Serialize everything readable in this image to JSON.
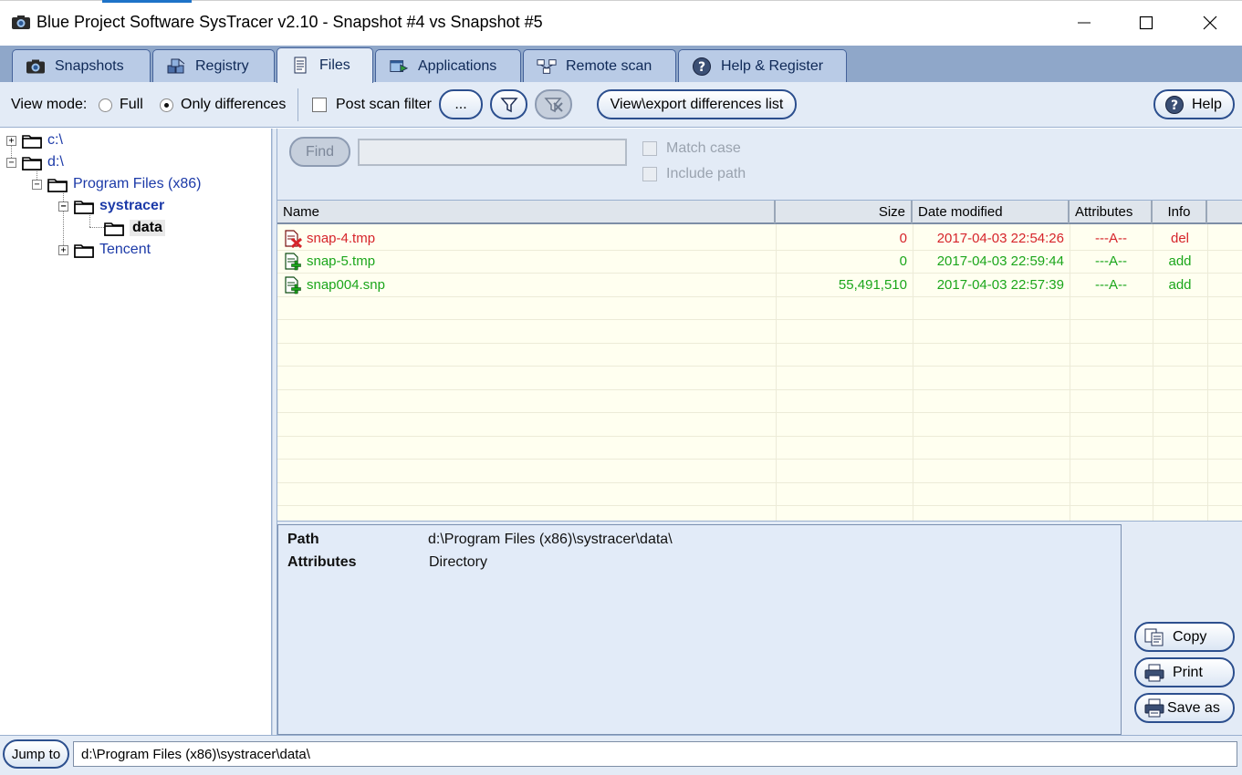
{
  "window": {
    "title": "Blue Project Software SysTracer v2.10 - Snapshot #4 vs Snapshot #5",
    "icon": "camera-icon"
  },
  "tabs": [
    {
      "label": "Snapshots",
      "icon": "camera-icon",
      "active": false
    },
    {
      "label": "Registry",
      "icon": "registry-cubes-icon",
      "active": false
    },
    {
      "label": "Files",
      "icon": "document-icon",
      "active": true
    },
    {
      "label": "Applications",
      "icon": "applications-icon",
      "active": false
    },
    {
      "label": "Remote scan",
      "icon": "network-icon",
      "active": false
    },
    {
      "label": "Help & Register",
      "icon": "question-icon",
      "active": false
    }
  ],
  "toolbar": {
    "view_mode_label": "View mode:",
    "full_label": "Full",
    "only_diff_label": "Only differences",
    "selected_mode": "Only differences",
    "post_scan_filter_label": "Post scan filter",
    "post_scan_filter_checked": false,
    "ellipsis_label": "...",
    "view_export_label": "View\\export differences list",
    "help_label": "Help"
  },
  "tree": {
    "nodes": [
      {
        "label": "c:\\",
        "expander": "+"
      },
      {
        "label": "d:\\",
        "expander": "−"
      },
      {
        "label": "Program Files (x86)",
        "expander": "−"
      },
      {
        "label": "systracer",
        "expander": "−"
      },
      {
        "label": "data",
        "selected": true
      },
      {
        "label": "Tencent",
        "expander": "+"
      }
    ]
  },
  "find": {
    "button_label": "Find",
    "input_value": "",
    "match_case_label": "Match case",
    "include_path_label": "Include path"
  },
  "filelist": {
    "columns": [
      "Name",
      "Size",
      "Date modified",
      "Attributes",
      "Info"
    ],
    "rows": [
      {
        "name": "snap-4.tmp",
        "size": "0",
        "date": "2017-04-03 22:54:26",
        "attributes": "---A--",
        "info": "del",
        "status": "deleted",
        "icon": "file-deleted-icon"
      },
      {
        "name": "snap-5.tmp",
        "size": "0",
        "date": "2017-04-03 22:59:44",
        "attributes": "---A--",
        "info": "add",
        "status": "added",
        "icon": "file-added-icon"
      },
      {
        "name": "snap004.snp",
        "size": "55,491,510",
        "date": "2017-04-03 22:57:39",
        "attributes": "---A--",
        "info": "add",
        "status": "added",
        "icon": "file-added-icon"
      }
    ]
  },
  "details": {
    "path_label": "Path",
    "path_value": "d:\\Program Files (x86)\\systracer\\data\\",
    "attributes_label": "Attributes",
    "attributes_value": "Directory"
  },
  "actions": {
    "copy_label": "Copy",
    "print_label": "Print",
    "save_as_label": "Save as"
  },
  "statusbar": {
    "jump_to_label": "Jump to",
    "path_value": "d:\\Program Files (x86)\\systracer\\data\\"
  },
  "colors": {
    "deleted": "#d6242a",
    "added": "#1ba61b",
    "tab_strip": "#8fa7c9",
    "panel": "#e3ebf6",
    "tree_text": "#1c3aa8"
  }
}
